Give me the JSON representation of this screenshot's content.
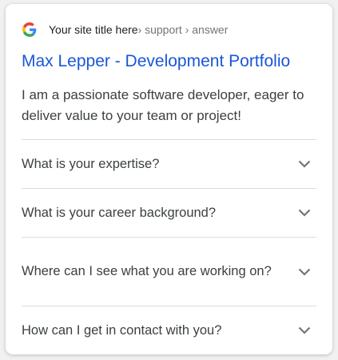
{
  "header": {
    "site_title": "Your site title here",
    "path": " › support › answer",
    "icon": "google-g-icon"
  },
  "result": {
    "title": "Max Lepper - Development Portfolio",
    "description": "I am a passionate software developer, eager to deliver value to your team or project!",
    "link_color": "#1a56d6"
  },
  "faq": [
    {
      "question": "What is your expertise?"
    },
    {
      "question": "What is your career background?"
    },
    {
      "question": "Where can I see what you are working on?"
    },
    {
      "question": "How can I get in contact with you?"
    }
  ]
}
